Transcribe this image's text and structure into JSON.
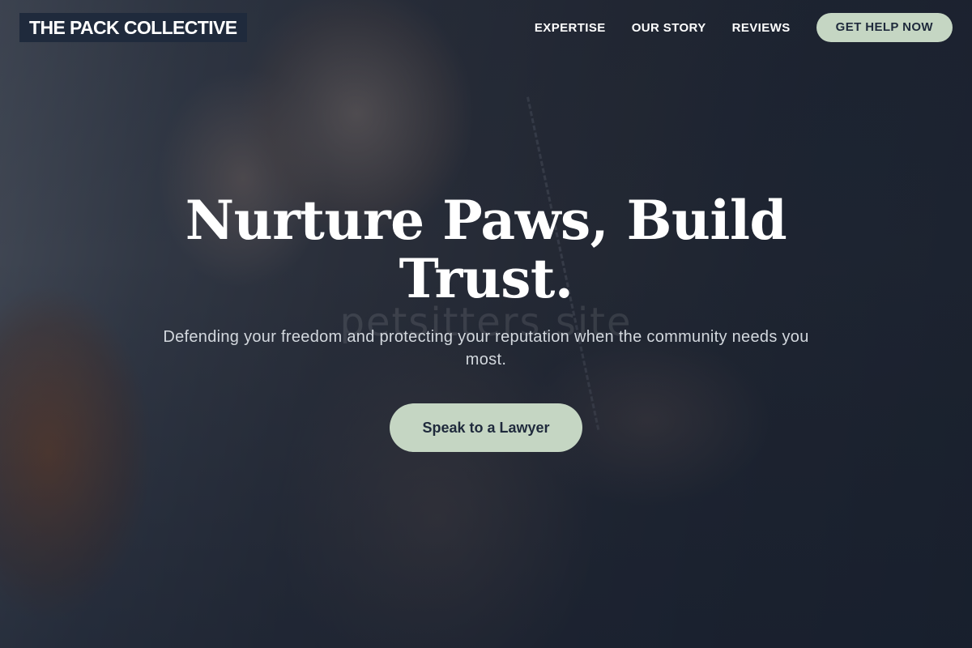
{
  "brand": {
    "name": "THE PACK COLLECTIVE"
  },
  "nav": {
    "items": [
      {
        "label": "EXPERTISE"
      },
      {
        "label": "OUR STORY"
      },
      {
        "label": "REVIEWS"
      }
    ],
    "cta_label": "GET HELP NOW"
  },
  "hero": {
    "headline": "Nurture Paws, Build Trust.",
    "subheadline": "Defending your freedom and protecting your reputation when the community needs you most.",
    "watermark": "petsitters.site",
    "cta_label": "Speak to a Lawyer"
  },
  "colors": {
    "accent": "#c5d6c3",
    "brand_bg": "#1f2a3c",
    "overlay": "#161e2e"
  }
}
